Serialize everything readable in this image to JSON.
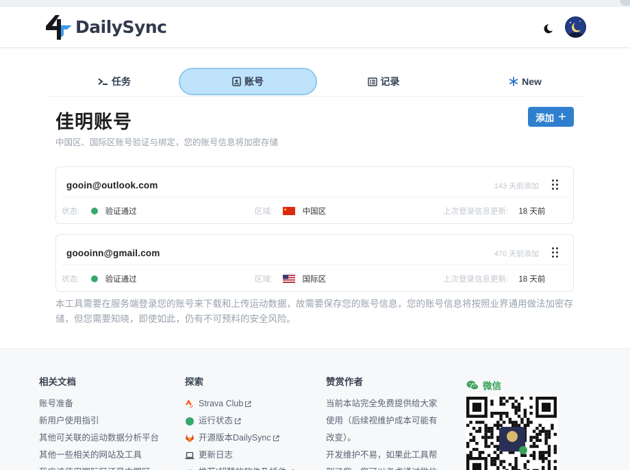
{
  "app": {
    "name": "DailySync"
  },
  "header": {
    "theme_toggle": "moon-icon",
    "avatar": "user-avatar"
  },
  "tabs": [
    {
      "label": "任务",
      "icon": "terminal-icon",
      "active": false
    },
    {
      "label": "账号",
      "icon": "id-card-icon",
      "active": true
    },
    {
      "label": "记录",
      "icon": "list-icon",
      "active": false
    },
    {
      "label": "New",
      "icon": "snowflake-icon",
      "active": false
    }
  ],
  "page": {
    "title": "佳明账号",
    "subtitle": "中国区、国际区账号验证与绑定，您的账号信息将加密存储",
    "add_button": "添加",
    "add_icon": "plus-icon"
  },
  "labels": {
    "status": "状态:",
    "region": "区域:",
    "last_login": "上次登录信息更新:"
  },
  "accounts": [
    {
      "email": "gooin@outlook.com",
      "added": "143 天前添加",
      "status": "验证通过",
      "region": "中国区",
      "flag": "china-flag",
      "last_update": "18 天前"
    },
    {
      "email": "goooinn@gmail.com",
      "added": "470 天前添加",
      "status": "验证通过",
      "region": "国际区",
      "flag": "usa-flag",
      "last_update": "18 天前"
    }
  ],
  "notice": "本工具需要在服务端登录您的账号来下载和上传运动数据，故需要保存您的账号信息，您的账号信息将按照业界通用做法加密存储，但您需要知晓，即使如此，仍有不可预料的安全风险。",
  "footer": {
    "docs": {
      "title": "相关文档",
      "links": [
        "账号准备",
        "新用户使用指引",
        "其他可关联的运动数据分析平台",
        "其他一些相关的网站及工具",
        "我应该使用国际区还是中国区"
      ]
    },
    "explore": {
      "title": "探索",
      "links": [
        {
          "label": "Strava Club",
          "icon": "strava-icon"
        },
        {
          "label": "运行状态",
          "icon": "status-dot-icon"
        },
        {
          "label": "开源版本DailySync",
          "icon": "gitlab-icon"
        },
        {
          "label": "更新日志",
          "icon": "laptop-icon"
        },
        {
          "label": "推荐!超赞的软件及插件",
          "icon": "code-icon"
        }
      ]
    },
    "sponsor": {
      "title": "赞赏作者",
      "lines": [
        "当前本站完全免费提供给大家使用（后续视维护成本可能有改变）。",
        "开发维护不易，如果此工具帮到了您，您可以考虑通过微信"
      ]
    },
    "wechat": {
      "label": "微信",
      "icon": "wechat-icon"
    }
  }
}
